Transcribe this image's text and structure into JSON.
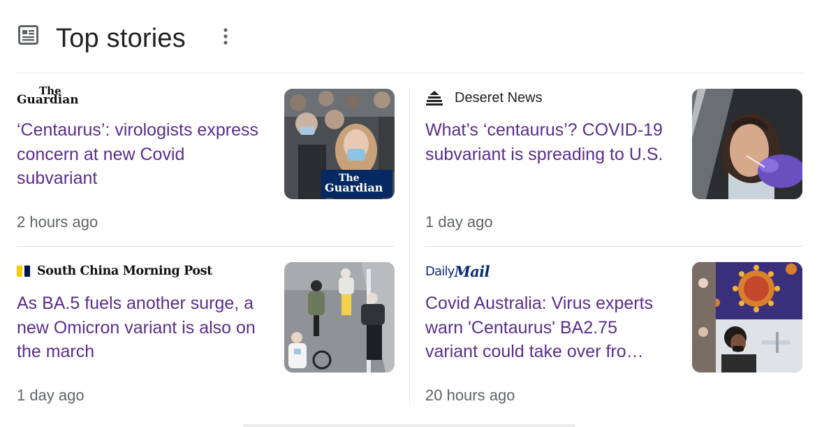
{
  "header": {
    "title": "Top stories",
    "icon": "news-article-icon",
    "more_icon": "more-vert-icon"
  },
  "colors": {
    "headline": "#5a2d8c",
    "timestamp": "#5f6368",
    "divider": "#dadce0",
    "dailymail_blue": "#0a2b78",
    "scmp_yellow": "#ffca05"
  },
  "stories": [
    {
      "source": {
        "the": "The",
        "name": "Guardian"
      },
      "headline": "‘Centaurus’: virologists express concern at new Covid subvariant",
      "time": "2 hours ago",
      "thumbnail": {
        "logo_the": "The",
        "logo_name": "Guardian"
      }
    },
    {
      "source": {
        "name": "Deseret News",
        "icon": "deseret-beehive-icon"
      },
      "headline": "What’s ‘centaurus’? COVID-19 subvariant is spreading to U.S.",
      "time": "1 day ago"
    },
    {
      "source": {
        "name": "South China Morning Post"
      },
      "headline": "As BA.5 fuels another surge, a new Omicron variant is also on the march",
      "time": "1 day ago"
    },
    {
      "source": {
        "daily": "Daily",
        "mail": "Mail"
      },
      "headline": "Covid Australia: Virus experts warn 'Centaurus' BA2.75 variant could take over fro…",
      "time": "20 hours ago"
    }
  ]
}
